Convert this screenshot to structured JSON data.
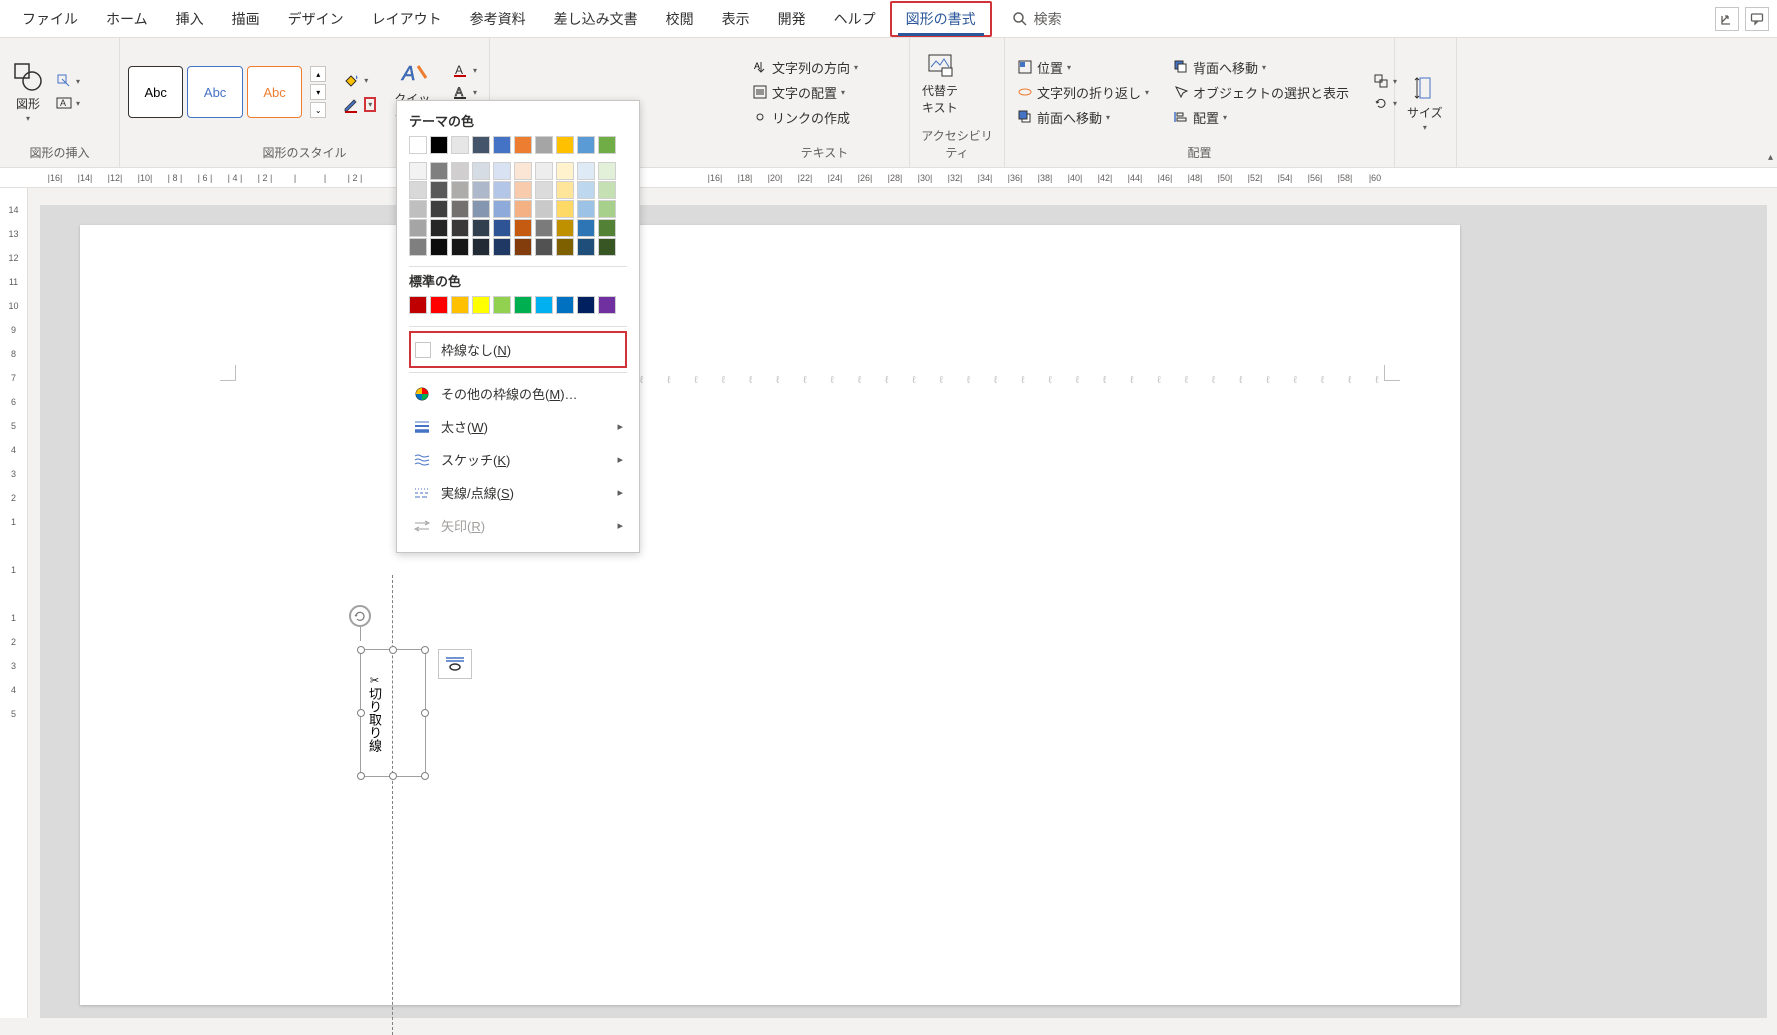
{
  "tabs": {
    "file": "ファイル",
    "home": "ホーム",
    "insert": "挿入",
    "draw": "描画",
    "design": "デザイン",
    "layout": "レイアウト",
    "references": "参考資料",
    "mailings": "差し込み文書",
    "review": "校閲",
    "view": "表示",
    "developer": "開発",
    "help": "ヘルプ",
    "shapeformat": "図形の書式"
  },
  "search": {
    "label": "検索"
  },
  "groups": {
    "insert_shapes": {
      "label": "図形の挿入",
      "shapes": "図形"
    },
    "styles": {
      "label": "図形のスタイル",
      "abc": "Abc",
      "quick": "クイック"
    },
    "text": {
      "label": "テキスト",
      "direction": "文字列の方向",
      "align": "文字の配置",
      "link": "リンクの作成"
    },
    "accessibility": {
      "label": "アクセシビリティ",
      "alt": "代替テ\nキスト"
    },
    "arrange": {
      "label": "配置",
      "position": "位置",
      "wrap": "文字列の折り返し",
      "forward": "前面へ移動",
      "backward": "背面へ移動",
      "selection": "オブジェクトの選択と表示",
      "alignbtn": "配置"
    },
    "size": {
      "label": "サイズ"
    }
  },
  "dropdown": {
    "theme_colors": "テーマの色",
    "standard_colors": "標準の色",
    "no_outline": "枠線なし(N)",
    "more_colors": "その他の枠線の色(M)…",
    "weight": "太さ(W)",
    "sketch": "スケッチ(K)",
    "dashes": "実線/点線(S)",
    "arrows": "矢印(R)"
  },
  "shape_text": {
    "label": "切り取り線"
  },
  "ruler_h": [
    "|16|",
    "|14|",
    "|12|",
    "|10|",
    "| 8 |",
    "| 6 |",
    "| 4 |",
    "| 2 |",
    "|",
    "|",
    "| 2 |",
    "",
    "",
    "",
    "",
    "",
    "",
    "",
    "",
    "",
    "",
    "",
    "|16|",
    "|18|",
    "|20|",
    "|22|",
    "|24|",
    "|26|",
    "|28|",
    "|30|",
    "|32|",
    "|34|",
    "|36|",
    "|38|",
    "|40|",
    "|42|",
    "|44|",
    "|46|",
    "|48|",
    "|50|",
    "|52|",
    "|54|",
    "|56|",
    "|58|",
    "|60"
  ],
  "ruler_v": [
    "14",
    "13",
    "12",
    "11",
    "10",
    "9",
    "8",
    "7",
    "6",
    "5",
    "4",
    "3",
    "2",
    "1",
    "",
    "1",
    "",
    "1",
    "2",
    "3",
    "4",
    "5"
  ],
  "theme_palette": {
    "row0": [
      "#ffffff",
      "#000000",
      "#e7e6e6",
      "#44546a",
      "#4472c4",
      "#ed7d31",
      "#a5a5a5",
      "#ffc000",
      "#5b9bd5",
      "#70ad47"
    ],
    "shades": [
      [
        "#f2f2f2",
        "#7f7f7f",
        "#d0cece",
        "#d6dce4",
        "#d9e2f3",
        "#fbe5d5",
        "#ededed",
        "#fff2cc",
        "#deebf6",
        "#e2efd9"
      ],
      [
        "#d8d8d8",
        "#595959",
        "#aeabab",
        "#adb9ca",
        "#b4c6e7",
        "#f7cbac",
        "#dbdbdb",
        "#fee599",
        "#bdd7ee",
        "#c5e0b3"
      ],
      [
        "#bfbfbf",
        "#3f3f3f",
        "#757070",
        "#8496b0",
        "#8eaadb",
        "#f4b183",
        "#c9c9c9",
        "#ffd965",
        "#9cc3e5",
        "#a8d08d"
      ],
      [
        "#a5a5a5",
        "#262626",
        "#3a3838",
        "#323f4f",
        "#2f5496",
        "#c55a11",
        "#7b7b7b",
        "#bf9000",
        "#2e75b5",
        "#538135"
      ],
      [
        "#7f7f7f",
        "#0c0c0c",
        "#171616",
        "#222a35",
        "#1f3864",
        "#833c0b",
        "#525252",
        "#7f6000",
        "#1e4e79",
        "#375623"
      ]
    ]
  },
  "standard_palette": [
    "#c00000",
    "#ff0000",
    "#ffc000",
    "#ffff00",
    "#92d050",
    "#00b050",
    "#00b0f0",
    "#0070c0",
    "#002060",
    "#7030a0"
  ]
}
